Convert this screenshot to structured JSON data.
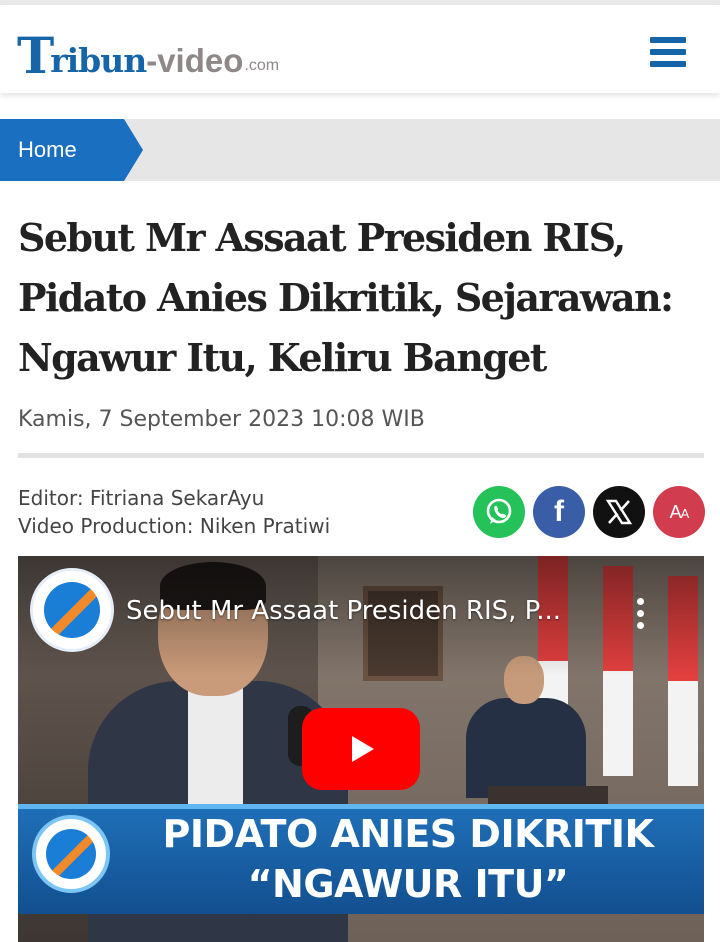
{
  "header": {
    "logo_mark": "T",
    "logo_word": "ribun",
    "logo_video": "-video",
    "logo_com": ".com",
    "menu_icon": "hamburger-menu-icon",
    "brand_color": "#1565a8"
  },
  "breadcrumb": {
    "home_label": "Home",
    "color": "#1a6fc0"
  },
  "article": {
    "title": "Sebut Mr Assaat Presiden RIS, Pidato Anies Dikritik, Sejarawan: Ngawur Itu, Keliru Banget",
    "date": "Kamis, 7 September 2023 10:08 WIB",
    "editor": "Editor: Fitriana SekarAyu",
    "video_production": "Video Production: Niken Pratiwi"
  },
  "share": {
    "items": [
      {
        "name": "whatsapp-icon",
        "color": "#25c25a"
      },
      {
        "name": "facebook-icon",
        "label": "f",
        "color": "#3a5da8"
      },
      {
        "name": "x-icon",
        "color": "#111111"
      },
      {
        "name": "font-size-icon",
        "label_big": "A",
        "label_small": "A",
        "color": "#d23c4f"
      }
    ]
  },
  "video": {
    "title": "Sebut Mr Assaat Presiden RIS, P...",
    "banner_line1": "PIDATO ANIES DIKRITIK",
    "banner_line2": "“NGAWUR ITU”",
    "play_color": "#ff0000"
  }
}
